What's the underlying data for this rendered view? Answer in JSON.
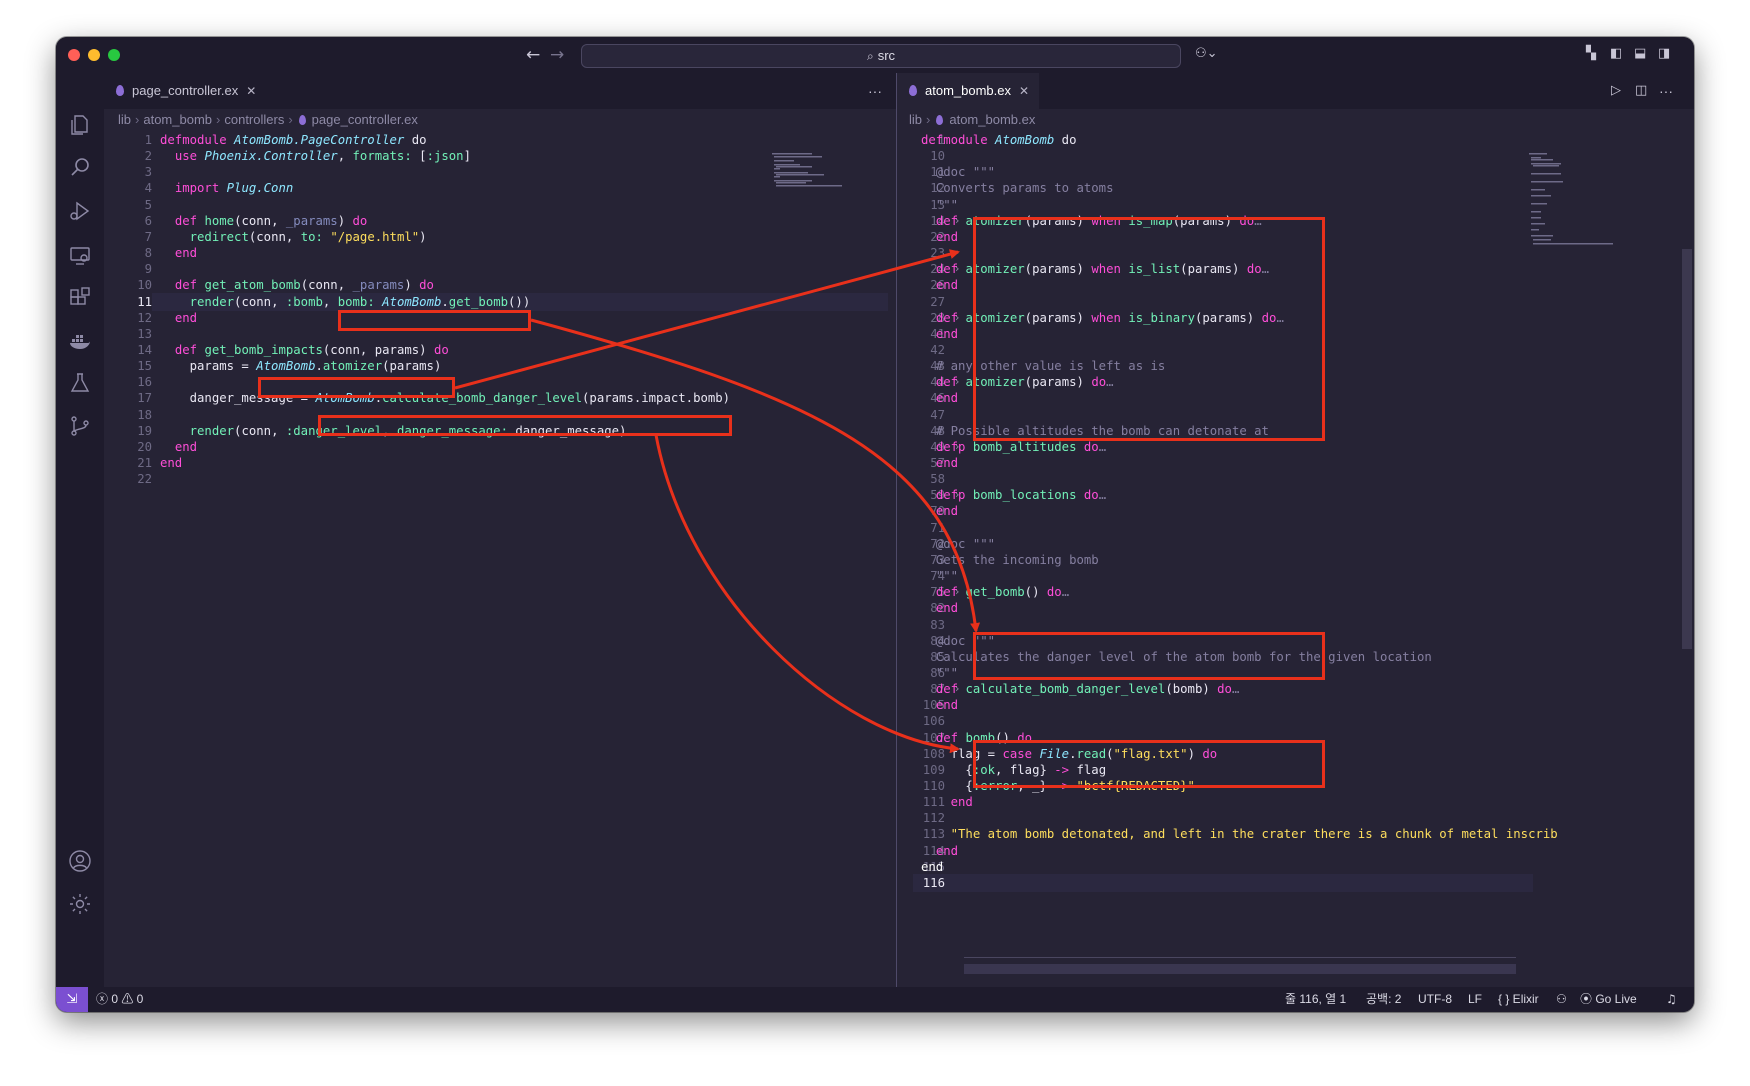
{
  "titlebar": {
    "search_text": "src",
    "back_icon": "arrow-left-icon",
    "forward_icon": "arrow-right-icon",
    "traffic_colors": [
      "#ff5f57",
      "#febc2e",
      "#28c840"
    ]
  },
  "activity_bar": {
    "items": [
      "files-icon",
      "search-icon",
      "run-debug-icon",
      "remote-explorer-icon",
      "extensions-icon",
      "docker-icon",
      "testing-icon",
      "source-control-icon"
    ],
    "bottom": [
      "account-icon",
      "settings-gear-icon"
    ]
  },
  "left_editor": {
    "tab": "page_controller.ex",
    "more": "···",
    "breadcrumb": [
      "lib",
      "atom_bomb",
      "controllers",
      "page_controller.ex"
    ],
    "lines": [
      {
        "n": "1",
        "t": [
          [
            "k",
            "defmodule "
          ],
          [
            "m",
            "AtomBomb.PageController"
          ],
          [
            "p",
            " do"
          ]
        ]
      },
      {
        "n": "2",
        "t": [
          [
            "p",
            "  "
          ],
          [
            "k",
            "use "
          ],
          [
            "m",
            "Phoenix.Controller"
          ],
          [
            "p",
            ", "
          ],
          [
            "a",
            "formats:"
          ],
          [
            "p",
            " ["
          ],
          [
            "a",
            ":json"
          ],
          [
            "p",
            "]"
          ]
        ]
      },
      {
        "n": "3",
        "t": []
      },
      {
        "n": "4",
        "t": [
          [
            "p",
            "  "
          ],
          [
            "k",
            "import "
          ],
          [
            "m",
            "Plug.Conn"
          ]
        ]
      },
      {
        "n": "5",
        "t": []
      },
      {
        "n": "6",
        "t": [
          [
            "p",
            "  "
          ],
          [
            "k",
            "def "
          ],
          [
            "a",
            "home"
          ],
          [
            "p",
            "(conn, "
          ],
          [
            "u",
            "_params"
          ],
          [
            "p",
            ") "
          ],
          [
            "k",
            "do"
          ]
        ]
      },
      {
        "n": "7",
        "t": [
          [
            "p",
            "    "
          ],
          [
            "a",
            "redirect"
          ],
          [
            "p",
            "(conn, "
          ],
          [
            "a",
            "to:"
          ],
          [
            "p",
            " "
          ],
          [
            "y",
            "\"/page.html\""
          ],
          [
            "p",
            ")"
          ]
        ]
      },
      {
        "n": "8",
        "t": [
          [
            "p",
            "  "
          ],
          [
            "k",
            "end"
          ]
        ]
      },
      {
        "n": "9",
        "t": []
      },
      {
        "n": "10",
        "t": [
          [
            "p",
            "  "
          ],
          [
            "k",
            "def "
          ],
          [
            "a",
            "get_atom_bomb"
          ],
          [
            "p",
            "(conn, "
          ],
          [
            "u",
            "_params"
          ],
          [
            "p",
            ") "
          ],
          [
            "k",
            "do"
          ]
        ]
      },
      {
        "n": "11",
        "t": [
          [
            "p",
            "    "
          ],
          [
            "a",
            "render"
          ],
          [
            "p",
            "(conn, "
          ],
          [
            "a",
            ":bomb"
          ],
          [
            "p",
            ", "
          ],
          [
            "a",
            "bomb:"
          ],
          [
            "p",
            " "
          ],
          [
            "m",
            "AtomBomb"
          ],
          [
            "p",
            "."
          ],
          [
            "a",
            "get_bomb"
          ],
          [
            "p",
            "())"
          ]
        ],
        "cur": true
      },
      {
        "n": "12",
        "t": [
          [
            "p",
            "  "
          ],
          [
            "k",
            "end"
          ]
        ]
      },
      {
        "n": "13",
        "t": []
      },
      {
        "n": "14",
        "t": [
          [
            "p",
            "  "
          ],
          [
            "k",
            "def "
          ],
          [
            "a",
            "get_bomb_impacts"
          ],
          [
            "p",
            "(conn, params) "
          ],
          [
            "k",
            "do"
          ]
        ]
      },
      {
        "n": "15",
        "t": [
          [
            "p",
            "    params = "
          ],
          [
            "m",
            "AtomBomb"
          ],
          [
            "p",
            "."
          ],
          [
            "a",
            "atomizer"
          ],
          [
            "p",
            "(params)"
          ]
        ]
      },
      {
        "n": "16",
        "t": []
      },
      {
        "n": "17",
        "t": [
          [
            "p",
            "    danger_message = "
          ],
          [
            "m",
            "AtomBomb"
          ],
          [
            "p",
            "."
          ],
          [
            "a",
            "calculate_bomb_danger_level"
          ],
          [
            "p",
            "(params.impact.bomb)"
          ]
        ]
      },
      {
        "n": "18",
        "t": []
      },
      {
        "n": "19",
        "t": [
          [
            "p",
            "    "
          ],
          [
            "a",
            "render"
          ],
          [
            "p",
            "(conn, "
          ],
          [
            "a",
            ":danger_level"
          ],
          [
            "p",
            ", "
          ],
          [
            "a",
            "danger_message:"
          ],
          [
            "p",
            " danger_message)"
          ]
        ]
      },
      {
        "n": "20",
        "t": [
          [
            "p",
            "  "
          ],
          [
            "k",
            "end"
          ]
        ]
      },
      {
        "n": "21",
        "t": [
          [
            "k",
            "end"
          ]
        ]
      },
      {
        "n": "22",
        "t": []
      }
    ]
  },
  "right_editor": {
    "tab": "atom_bomb.ex",
    "breadcrumb": [
      "lib",
      "atom_bomb.ex"
    ],
    "lines": [
      {
        "n": "1",
        "t": [
          [
            "k",
            "defmodule "
          ],
          [
            "m",
            "AtomBomb"
          ],
          [
            "p",
            " do"
          ]
        ]
      },
      {
        "n": "10",
        "t": []
      },
      {
        "n": "11",
        "t": [
          [
            "c",
            "  @doc \"\"\""
          ]
        ]
      },
      {
        "n": "12",
        "t": [
          [
            "c",
            "  Converts params to atoms"
          ]
        ]
      },
      {
        "n": "13",
        "t": [
          [
            "c",
            "  \"\"\""
          ]
        ]
      },
      {
        "n": "14",
        "t": [
          [
            "p",
            "  "
          ],
          [
            "k",
            "def "
          ],
          [
            "a",
            "atomizer"
          ],
          [
            "p",
            "(params) "
          ],
          [
            "k",
            "when "
          ],
          [
            "a",
            "is_map"
          ],
          [
            "p",
            "(params) "
          ],
          [
            "k",
            "do"
          ],
          [
            "c",
            "…"
          ]
        ],
        "fold": true
      },
      {
        "n": "22",
        "t": [
          [
            "p",
            "  "
          ],
          [
            "k",
            "end"
          ]
        ]
      },
      {
        "n": "23",
        "t": []
      },
      {
        "n": "24",
        "t": [
          [
            "p",
            "  "
          ],
          [
            "k",
            "def "
          ],
          [
            "a",
            "atomizer"
          ],
          [
            "p",
            "(params) "
          ],
          [
            "k",
            "when "
          ],
          [
            "a",
            "is_list"
          ],
          [
            "p",
            "(params) "
          ],
          [
            "k",
            "do"
          ],
          [
            "c",
            "…"
          ]
        ],
        "fold": true
      },
      {
        "n": "26",
        "t": [
          [
            "p",
            "  "
          ],
          [
            "k",
            "end"
          ]
        ]
      },
      {
        "n": "27",
        "t": []
      },
      {
        "n": "28",
        "t": [
          [
            "p",
            "  "
          ],
          [
            "k",
            "def "
          ],
          [
            "a",
            "atomizer"
          ],
          [
            "p",
            "(params) "
          ],
          [
            "k",
            "when "
          ],
          [
            "a",
            "is_binary"
          ],
          [
            "p",
            "(params) "
          ],
          [
            "k",
            "do"
          ],
          [
            "c",
            "…"
          ]
        ],
        "fold": true
      },
      {
        "n": "41",
        "t": [
          [
            "p",
            "  "
          ],
          [
            "k",
            "end"
          ]
        ]
      },
      {
        "n": "42",
        "t": []
      },
      {
        "n": "43",
        "t": [
          [
            "c",
            "  # any other value is left as is"
          ]
        ]
      },
      {
        "n": "44",
        "t": [
          [
            "p",
            "  "
          ],
          [
            "k",
            "def "
          ],
          [
            "a",
            "atomizer"
          ],
          [
            "p",
            "(params) "
          ],
          [
            "k",
            "do"
          ],
          [
            "c",
            "…"
          ]
        ],
        "fold": true
      },
      {
        "n": "46",
        "t": [
          [
            "p",
            "  "
          ],
          [
            "k",
            "end"
          ]
        ]
      },
      {
        "n": "47",
        "t": []
      },
      {
        "n": "48",
        "t": [
          [
            "c",
            "  # Possible altitudes the bomb can detonate at"
          ]
        ]
      },
      {
        "n": "49",
        "t": [
          [
            "p",
            "  "
          ],
          [
            "k",
            "defp "
          ],
          [
            "a",
            "bomb_altitudes"
          ],
          [
            "p",
            " "
          ],
          [
            "k",
            "do"
          ],
          [
            "c",
            "…"
          ]
        ],
        "fold": true
      },
      {
        "n": "57",
        "t": [
          [
            "p",
            "  "
          ],
          [
            "k",
            "end"
          ]
        ]
      },
      {
        "n": "58",
        "t": []
      },
      {
        "n": "59",
        "t": [
          [
            "p",
            "  "
          ],
          [
            "k",
            "defp "
          ],
          [
            "a",
            "bomb_locations"
          ],
          [
            "p",
            " "
          ],
          [
            "k",
            "do"
          ],
          [
            "c",
            "…"
          ]
        ],
        "fold": true
      },
      {
        "n": "70",
        "t": [
          [
            "p",
            "  "
          ],
          [
            "k",
            "end"
          ]
        ]
      },
      {
        "n": "71",
        "t": []
      },
      {
        "n": "72",
        "t": [
          [
            "c",
            "  @doc \"\"\""
          ]
        ]
      },
      {
        "n": "73",
        "t": [
          [
            "c",
            "  Gets the incoming bomb"
          ]
        ]
      },
      {
        "n": "74",
        "t": [
          [
            "c",
            "  \"\"\""
          ]
        ]
      },
      {
        "n": "75",
        "t": [
          [
            "p",
            "  "
          ],
          [
            "k",
            "def "
          ],
          [
            "a",
            "get_bomb"
          ],
          [
            "p",
            "() "
          ],
          [
            "k",
            "do"
          ],
          [
            "c",
            "…"
          ]
        ],
        "fold": true
      },
      {
        "n": "82",
        "t": [
          [
            "p",
            "  "
          ],
          [
            "k",
            "end"
          ]
        ]
      },
      {
        "n": "83",
        "t": []
      },
      {
        "n": "84",
        "t": [
          [
            "c",
            "  @doc \"\"\""
          ]
        ]
      },
      {
        "n": "85",
        "t": [
          [
            "c",
            "  Calculates the danger level of the atom bomb for the given location"
          ]
        ]
      },
      {
        "n": "86",
        "t": [
          [
            "c",
            "  \"\"\""
          ]
        ]
      },
      {
        "n": "87",
        "t": [
          [
            "p",
            "  "
          ],
          [
            "k",
            "def "
          ],
          [
            "a",
            "calculate_bomb_danger_level"
          ],
          [
            "p",
            "(bomb) "
          ],
          [
            "k",
            "do"
          ],
          [
            "c",
            "…"
          ]
        ],
        "fold": true
      },
      {
        "n": "105",
        "t": [
          [
            "p",
            "  "
          ],
          [
            "k",
            "end"
          ]
        ]
      },
      {
        "n": "106",
        "t": []
      },
      {
        "n": "107",
        "t": [
          [
            "p",
            "  "
          ],
          [
            "k",
            "def "
          ],
          [
            "a",
            "bomb"
          ],
          [
            "p",
            "() "
          ],
          [
            "k",
            "do"
          ]
        ]
      },
      {
        "n": "108",
        "t": [
          [
            "p",
            "    flag = "
          ],
          [
            "k",
            "case "
          ],
          [
            "m",
            "File"
          ],
          [
            "p",
            "."
          ],
          [
            "a",
            "read"
          ],
          [
            "p",
            "("
          ],
          [
            "y",
            "\"flag.txt\""
          ],
          [
            "p",
            ") "
          ],
          [
            "k",
            "do"
          ]
        ]
      },
      {
        "n": "109",
        "t": [
          [
            "p",
            "      {"
          ],
          [
            "a",
            ":ok"
          ],
          [
            "p",
            ", flag} "
          ],
          [
            "k",
            "->"
          ],
          [
            "p",
            " flag"
          ]
        ]
      },
      {
        "n": "110",
        "t": [
          [
            "p",
            "      {"
          ],
          [
            "a",
            ":error"
          ],
          [
            "p",
            ", _} "
          ],
          [
            "k",
            "->"
          ],
          [
            "p",
            " "
          ],
          [
            "y",
            "\"bctf{REDACTED}\""
          ]
        ]
      },
      {
        "n": "111",
        "t": [
          [
            "p",
            "    "
          ],
          [
            "k",
            "end"
          ]
        ]
      },
      {
        "n": "112",
        "t": []
      },
      {
        "n": "113",
        "t": [
          [
            "y",
            "    \"The atom bomb detonated, and left in the crater there is a chunk of metal inscrib"
          ]
        ]
      },
      {
        "n": "114",
        "t": [
          [
            "p",
            "  "
          ],
          [
            "k",
            "end"
          ]
        ]
      },
      {
        "n": "115",
        "t": [
          [
            "w",
            "end"
          ]
        ]
      },
      {
        "n": "116",
        "t": [],
        "cur": true
      }
    ]
  },
  "statusbar": {
    "remote_icon": "remote-window-icon",
    "problems": "ⓧ 0 ⚠ 0",
    "position": "줄 116, 열 1",
    "spaces": "공백: 2",
    "encoding": "UTF-8",
    "eol": "LF",
    "language": "{ } Elixir",
    "copilot_icon": "copilot-icon",
    "golive": "⦿ Go Live",
    "bell_icon": "bell-icon"
  },
  "annotation_color": "#e8301b"
}
